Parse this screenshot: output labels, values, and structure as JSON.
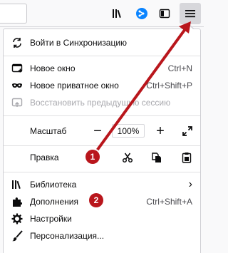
{
  "toolbar": {
    "icons": [
      "library-icon",
      "sync-icon",
      "sidebar-icon",
      "hamburger-menu-icon"
    ]
  },
  "menu": {
    "sync_label": "Войти в Синхронизацию",
    "new_window_label": "Новое окно",
    "new_window_shortcut": "Ctrl+N",
    "new_private_label": "Новое приватное окно",
    "new_private_shortcut": "Ctrl+Shift+P",
    "restore_session_label": "Восстановить предыдущую сессию",
    "zoom_label": "Масштаб",
    "zoom_minus": "−",
    "zoom_value": "100%",
    "zoom_plus": "+",
    "edit_label": "Правка",
    "library_label": "Библиотека",
    "library_chevron": "›",
    "addons_label": "Дополнения",
    "addons_shortcut": "Ctrl+Shift+A",
    "settings_label": "Настройки",
    "customize_label": "Персонализация..."
  },
  "annotations": {
    "badge1": "1",
    "badge2": "2",
    "color": "#b9161c"
  }
}
